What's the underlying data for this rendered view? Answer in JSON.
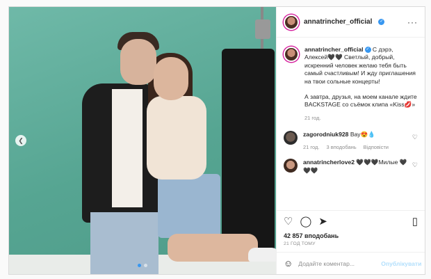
{
  "header": {
    "username": "annatrincher_official",
    "more_icon": "more-horizontal-icon"
  },
  "caption": {
    "username": "annatrincher_official",
    "text": "С дэрэ, Алексей🖤🖤 Светлый, добрый, искренний человек желаю тебя быть самый счастливым! И жду приглашения на твои сольные концерты!",
    "text2": "А завтра, друзья, на моем канале ждите BACKSTAGE со съёмок клипа «Kiss💋»",
    "time": "21 год."
  },
  "comments": [
    {
      "username": "zagorodniuk928",
      "text": "Вау😍💧",
      "time": "21 год.",
      "likes": "3 вподобань",
      "reply": "Відповісти"
    },
    {
      "username": "annatrincherlove2",
      "text": "🖤🖤🖤Милые 🖤🖤🖤",
      "time": "",
      "likes": "",
      "reply": ""
    }
  ],
  "likes": "42 857 вподобань",
  "timestamp": "21 ГОД ТОМУ",
  "add_comment": {
    "placeholder": "Додайте коментар...",
    "post_label": "Опублікувати"
  }
}
